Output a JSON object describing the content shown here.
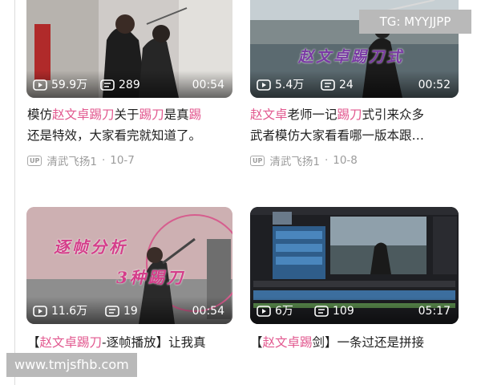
{
  "watermarks": {
    "tg": "TG: MYYJJPP",
    "url": "www.tmjsfhb.com"
  },
  "cards": [
    {
      "views": "59.9万",
      "comments": "289",
      "duration": "00:54",
      "title_line1": [
        {
          "t": "模仿",
          "h": false
        },
        {
          "t": "赵文卓",
          "h": true
        },
        {
          "t": "踢刀",
          "h": true
        },
        {
          "t": "关于",
          "h": false
        },
        {
          "t": "踢刀",
          "h": true
        },
        {
          "t": "是真",
          "h": false
        },
        {
          "t": "踢",
          "h": true
        }
      ],
      "title_line2": [
        {
          "t": "还是特效，大家看完就知道了。",
          "h": false
        }
      ],
      "uploader": "清武飞扬1",
      "date": "10-7",
      "overlay": ""
    },
    {
      "views": "5.4万",
      "comments": "24",
      "duration": "00:52",
      "title_line1": [
        {
          "t": "赵文卓",
          "h": true
        },
        {
          "t": "老师一记",
          "h": false
        },
        {
          "t": "踢刀",
          "h": true
        },
        {
          "t": "式引来众多",
          "h": false
        }
      ],
      "title_line2": [
        {
          "t": "武者模仿大家看看哪一版本跟…",
          "h": false
        }
      ],
      "uploader": "清武飞扬1",
      "date": "10-8",
      "overlay": "赵文卓踢刀式"
    },
    {
      "views": "11.6万",
      "comments": "19",
      "duration": "00:54",
      "title_line1": [
        {
          "t": "【",
          "h": false
        },
        {
          "t": "赵文卓",
          "h": true
        },
        {
          "t": "踢刀",
          "h": true
        },
        {
          "t": "-逐帧播放】让我真",
          "h": false
        }
      ],
      "overlay_a": "逐帧分析",
      "overlay_b": "3种踢刀"
    },
    {
      "views": "6万",
      "comments": "109",
      "duration": "05:17",
      "title_line1": [
        {
          "t": "【",
          "h": false
        },
        {
          "t": "赵文卓",
          "h": true
        },
        {
          "t": "踢",
          "h": true
        },
        {
          "t": "剑】一条过还是拼接",
          "h": false
        }
      ]
    }
  ]
}
